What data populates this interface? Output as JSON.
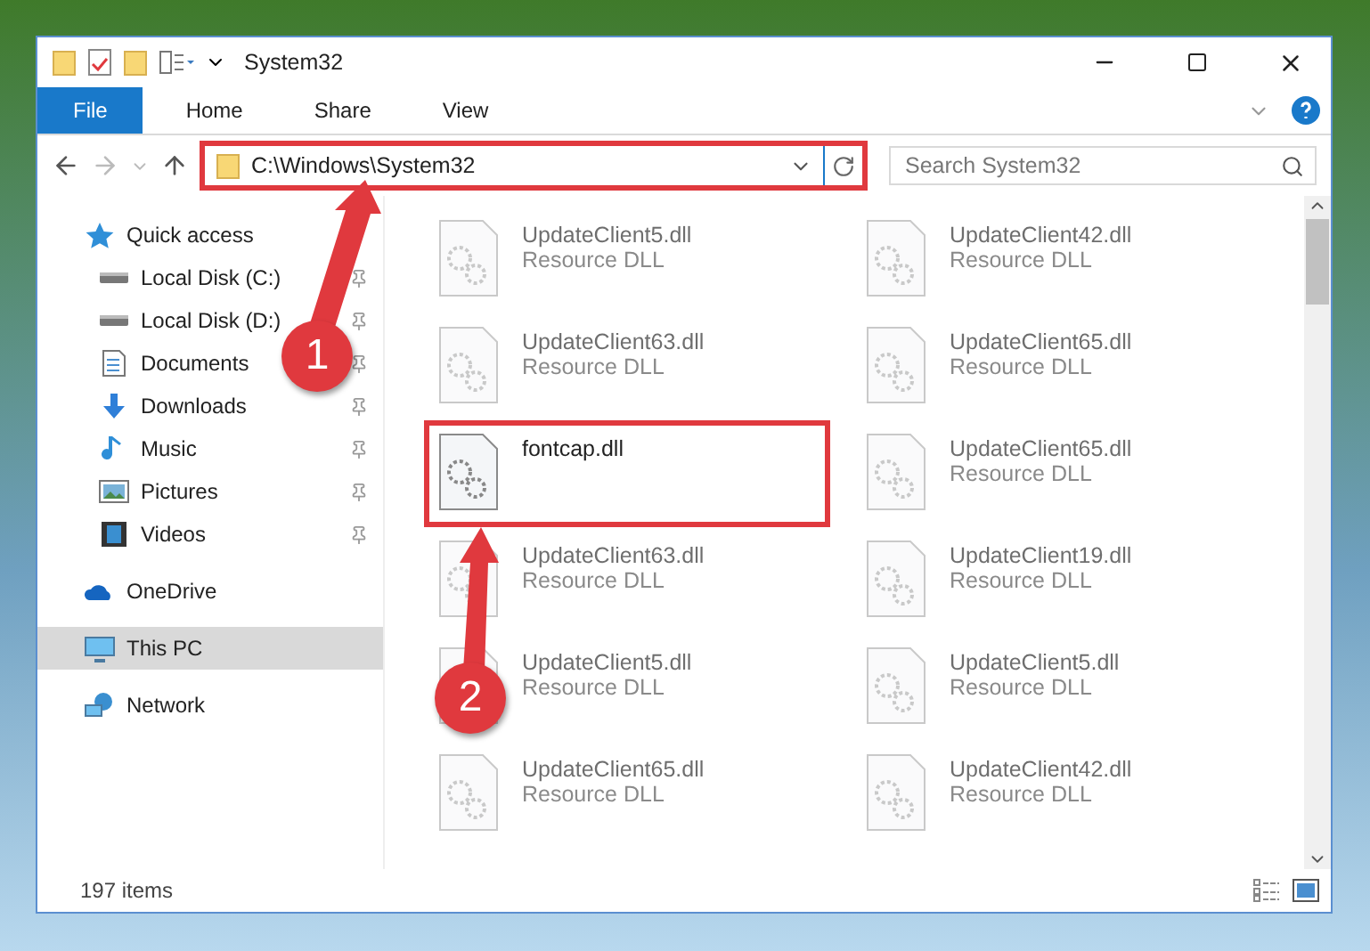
{
  "window": {
    "title": "System32"
  },
  "ribbon": {
    "tabs": [
      {
        "label": "File",
        "kind": "file"
      },
      {
        "label": "Home",
        "kind": "tab"
      },
      {
        "label": "Share",
        "kind": "tab"
      },
      {
        "label": "View",
        "kind": "tab"
      }
    ]
  },
  "address_bar": {
    "path": "C:\\Windows\\System32",
    "highlighted": true
  },
  "search": {
    "placeholder": "Search System32"
  },
  "sidebar": {
    "items": [
      {
        "label": "Quick access",
        "kind": "star",
        "selected": false,
        "children": [
          {
            "label": "Local Disk (C:)",
            "kind": "drive",
            "selected": false,
            "pinned": true
          },
          {
            "label": "Local Disk (D:)",
            "kind": "drive",
            "selected": false,
            "pinned": true
          },
          {
            "label": "Documents",
            "kind": "document",
            "selected": false,
            "pinned": true
          },
          {
            "label": "Downloads",
            "kind": "download",
            "selected": false,
            "pinned": true
          },
          {
            "label": "Music",
            "kind": "music",
            "selected": false,
            "pinned": true
          },
          {
            "label": "Pictures",
            "kind": "picture",
            "selected": false,
            "pinned": true
          },
          {
            "label": "Videos",
            "kind": "video",
            "selected": false,
            "pinned": true
          }
        ]
      },
      {
        "label": "OneDrive",
        "kind": "cloud",
        "selected": false
      },
      {
        "label": "This PC",
        "kind": "monitor",
        "selected": true
      },
      {
        "label": "Network",
        "kind": "network",
        "selected": false
      }
    ]
  },
  "files": [
    {
      "name": "UpdateClient5.dll",
      "type": "Resource DLL",
      "blurred": true,
      "highlighted": false
    },
    {
      "name": "UpdateClient42.dll",
      "type": "Resource DLL",
      "blurred": true,
      "highlighted": false
    },
    {
      "name": "UpdateClient63.dll",
      "type": "Resource DLL",
      "blurred": true,
      "highlighted": false
    },
    {
      "name": "UpdateClient65.dll",
      "type": "Resource DLL",
      "blurred": true,
      "highlighted": false
    },
    {
      "name": "fontcap.dll",
      "blurred": false,
      "highlighted": true
    },
    {
      "name": "UpdateClient65.dll",
      "type": "Resource DLL",
      "blurred": true,
      "highlighted": false
    },
    {
      "name": "UpdateClient63.dll",
      "type": "Resource DLL",
      "blurred": true,
      "highlighted": false
    },
    {
      "name": "UpdateClient19.dll",
      "type": "Resource DLL",
      "blurred": true,
      "highlighted": false
    },
    {
      "name": "UpdateClient5.dll",
      "type": "Resource DLL",
      "blurred": true,
      "highlighted": false
    },
    {
      "name": "UpdateClient5.dll",
      "type": "Resource DLL",
      "blurred": true,
      "highlighted": false
    },
    {
      "name": "UpdateClient65.dll",
      "type": "Resource DLL",
      "blurred": true,
      "highlighted": false
    },
    {
      "name": "UpdateClient42.dll",
      "type": "Resource DLL",
      "blurred": true,
      "highlighted": false
    }
  ],
  "annotations": [
    {
      "number": "1"
    },
    {
      "number": "2"
    }
  ],
  "status_bar": {
    "count": "197 items"
  }
}
